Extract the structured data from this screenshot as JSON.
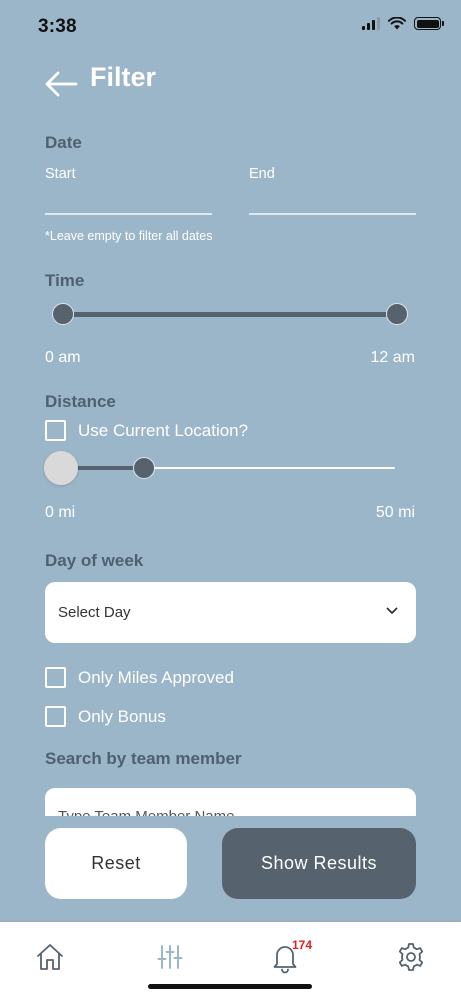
{
  "status_bar": {
    "time": "3:38"
  },
  "header": {
    "title": "Filter",
    "back_icon": "arrow-left-icon"
  },
  "date": {
    "label": "Date",
    "start_label": "Start",
    "end_label": "End",
    "hint": "*Leave empty to filter all dates"
  },
  "time": {
    "label": "Time",
    "min_label": "0 am",
    "max_label": "12 am",
    "range_start": 0,
    "range_end": 1
  },
  "distance": {
    "label": "Distance",
    "use_current_location": "Use Current Location?",
    "min_label": "0 mi",
    "max_label": "50 mi",
    "range_start": 0,
    "range_end": 0.25
  },
  "day_of_week": {
    "label": "Day of week",
    "select_value": "Select Day"
  },
  "options": {
    "miles_approved": "Only Miles Approved",
    "bonus": "Only Bonus"
  },
  "team_member": {
    "label": "Search by team member",
    "placeholder": "Type Team Member Name"
  },
  "actions": {
    "reset": "Reset",
    "show_results": "Show Results"
  },
  "tab_bar": {
    "items": [
      "home-icon",
      "sliders-icon",
      "bell-icon",
      "gear-icon"
    ],
    "notification_count": "174",
    "active_color": "#9cb6c9"
  },
  "colors": {
    "background": "#9cb6c9",
    "accent_dark": "#56636f",
    "badge": "#e02020"
  }
}
